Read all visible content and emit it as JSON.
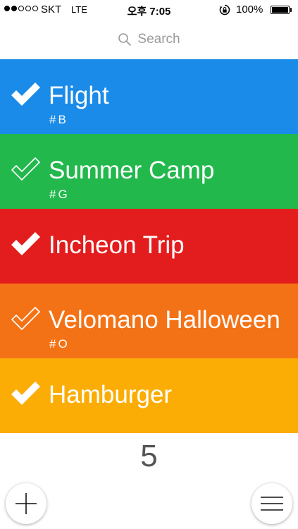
{
  "status_bar": {
    "carrier": "SKT",
    "network": "LTE",
    "time": "오후 7:05",
    "battery": "100%",
    "signal_bars_filled": 2,
    "signal_bars_total": 5
  },
  "search": {
    "placeholder": "Search",
    "icon": "search-icon"
  },
  "lists": [
    {
      "title": "Flight",
      "tag": "#B",
      "color": "#1a8be8",
      "checked": true
    },
    {
      "title": "Summer Camp",
      "tag": "#G",
      "color": "#22b84c",
      "checked": false
    },
    {
      "title": "Incheon Trip",
      "tag": "",
      "color": "#e31d1d",
      "checked": true
    },
    {
      "title": "Velomano Halloween",
      "tag": "#O",
      "color": "#f47216",
      "checked": false
    },
    {
      "title": "Hamburger",
      "tag": "",
      "color": "#fbad06",
      "checked": true
    }
  ],
  "count": "5",
  "buttons": {
    "add_icon": "plus-icon",
    "menu_icon": "hamburger-menu-icon"
  }
}
